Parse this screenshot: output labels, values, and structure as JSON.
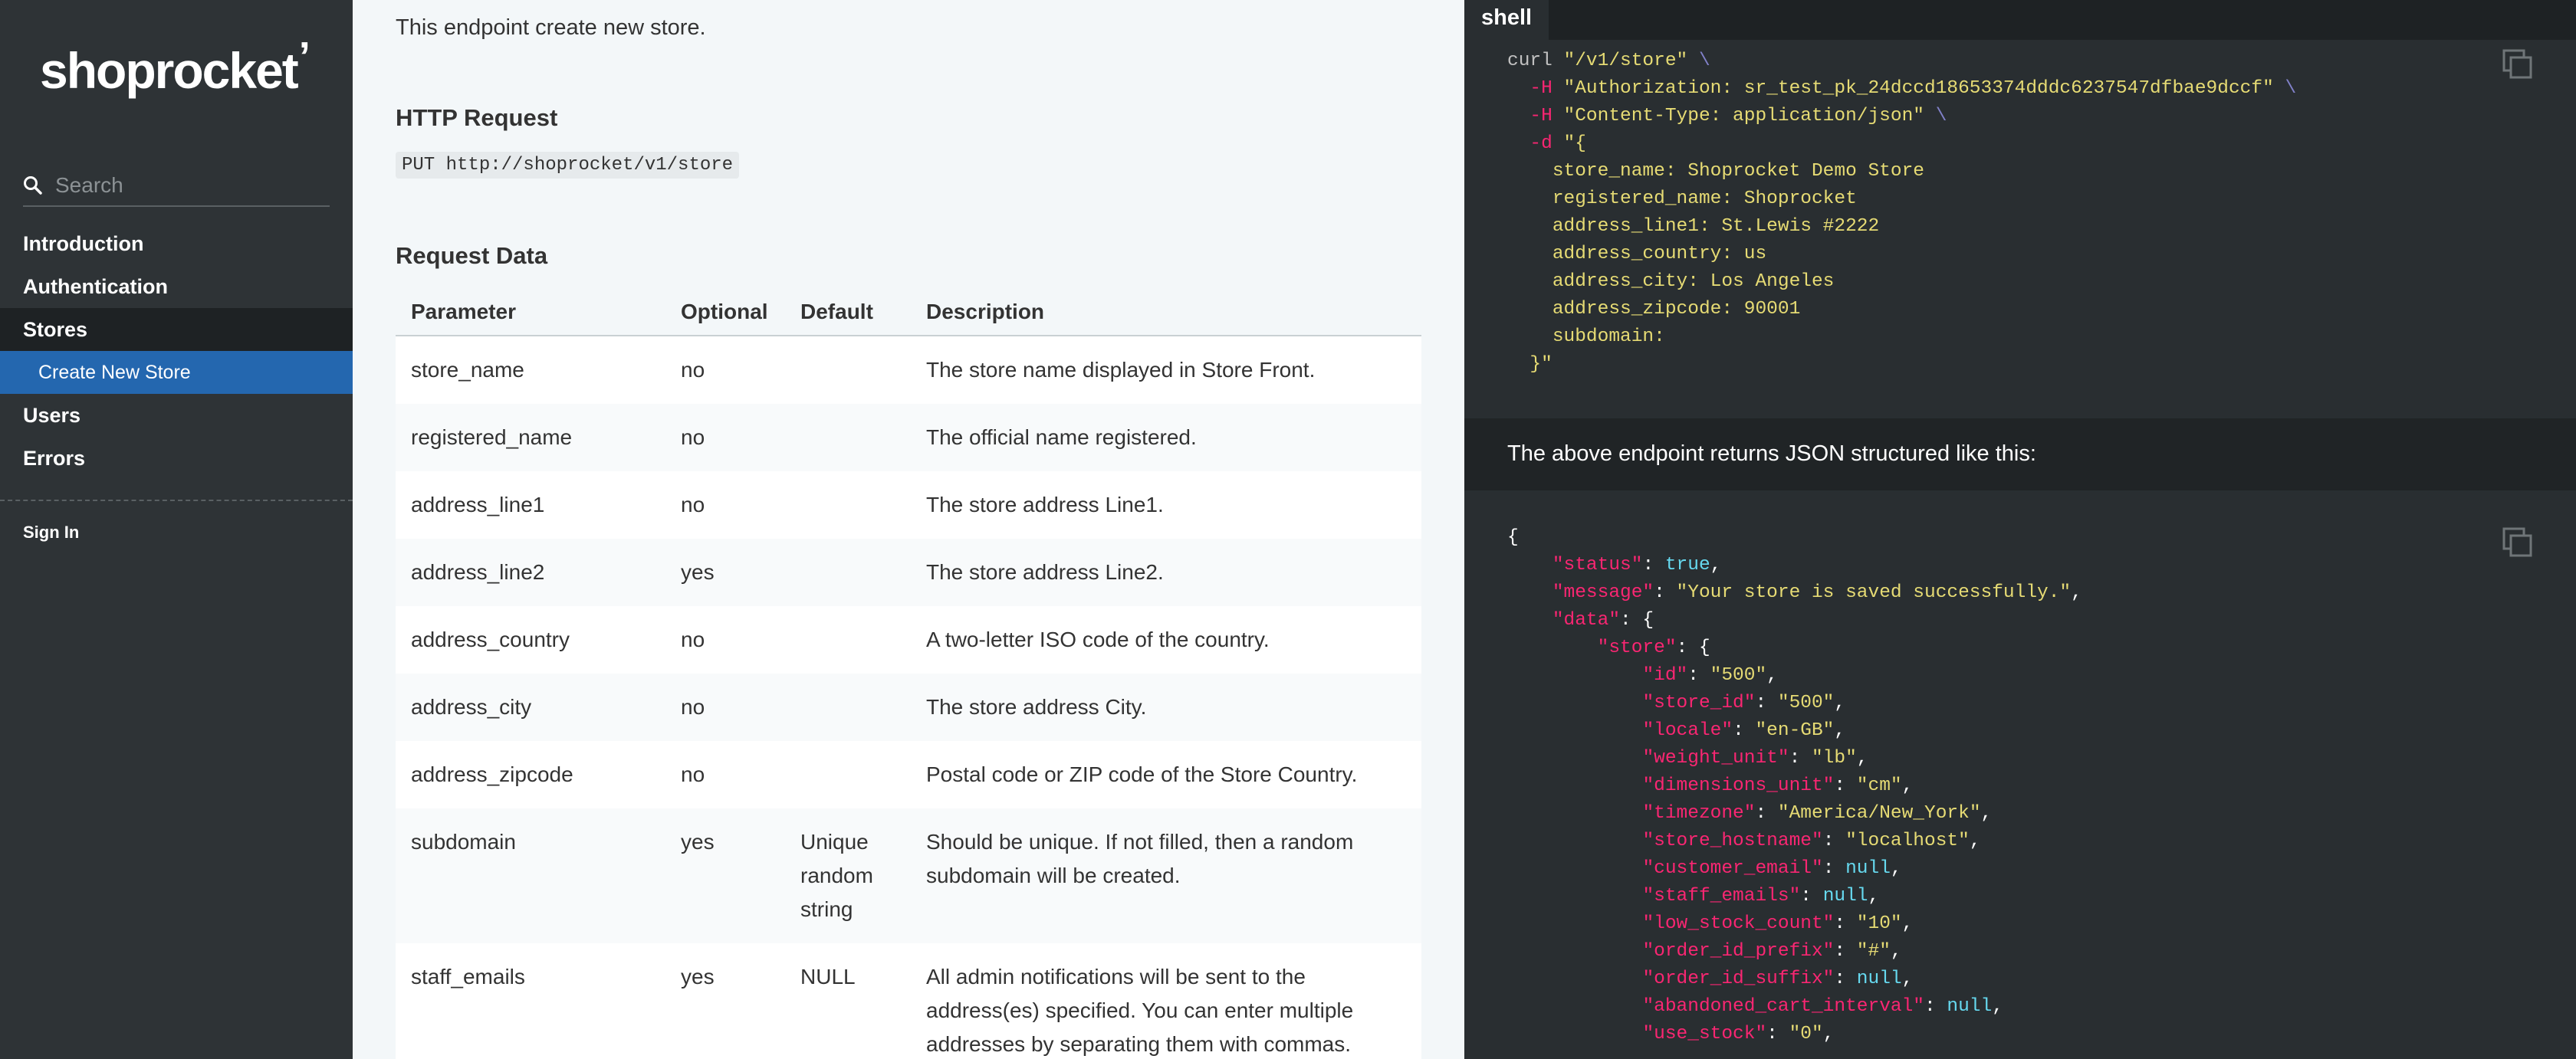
{
  "sidebar": {
    "logo": "shoprocket",
    "search_placeholder": "Search",
    "items": [
      {
        "label": "Introduction"
      },
      {
        "label": "Authentication"
      },
      {
        "label": "Stores"
      },
      {
        "label": "Create New Store"
      },
      {
        "label": "Users"
      },
      {
        "label": "Errors"
      }
    ],
    "sign_in": "Sign In"
  },
  "content": {
    "intro": "This endpoint create new store.",
    "http_heading": "HTTP Request",
    "http_code": "PUT http://shoprocket/v1/store",
    "request_heading": "Request Data",
    "table": {
      "headers": [
        "Parameter",
        "Optional",
        "Default",
        "Description"
      ],
      "rows": [
        {
          "param": "store_name",
          "optional": "no",
          "default": "",
          "desc": "The store name displayed in Store Front."
        },
        {
          "param": "registered_name",
          "optional": "no",
          "default": "",
          "desc": "The official name registered."
        },
        {
          "param": "address_line1",
          "optional": "no",
          "default": "",
          "desc": "The store address Line1."
        },
        {
          "param": "address_line2",
          "optional": "yes",
          "default": "",
          "desc": "The store address Line2."
        },
        {
          "param": "address_country",
          "optional": "no",
          "default": "",
          "desc": "A two-letter ISO code of the country."
        },
        {
          "param": "address_city",
          "optional": "no",
          "default": "",
          "desc": "The store address City."
        },
        {
          "param": "address_zipcode",
          "optional": "no",
          "default": "",
          "desc": "Postal code or ZIP code of the Store Country."
        },
        {
          "param": "subdomain",
          "optional": "yes",
          "default": "Unique random string",
          "desc": "Should be unique. If not filled, then a random subdomain will be created."
        },
        {
          "param": "staff_emails",
          "optional": "yes",
          "default": "NULL",
          "desc": "All admin notifications will be sent to the address(es) specified. You can enter multiple addresses by separating them with commas."
        }
      ]
    }
  },
  "code": {
    "tab": "shell",
    "curl": {
      "cmd": "curl",
      "url": "\"/v1/store\"",
      "h1_flag": "-H",
      "h1": "\"Authorization: sr_test_pk_24dccd18653374dddc6237547dfbae9dccf\"",
      "h2_flag": "-H",
      "h2": "\"Content-Type: application/json\"",
      "d_flag": "-d",
      "d_open": "\"{",
      "fields": [
        "store_name: Shoprocket Demo Store",
        "registered_name: Shoprocket",
        "address_line1: St.Lewis #2222",
        "address_country: us",
        "address_city: Los Angeles",
        "address_zipcode: 90001",
        "subdomain:"
      ],
      "d_close": "}\""
    },
    "returns_text": "The above endpoint returns JSON structured like this:",
    "json": {
      "status_key": "\"status\"",
      "status_val": "true",
      "message_key": "\"message\"",
      "message_val": "\"Your store is saved successfully.\"",
      "data_key": "\"data\"",
      "store_key": "\"store\"",
      "fields": [
        {
          "k": "\"id\"",
          "v": "\"500\"",
          "t": "str"
        },
        {
          "k": "\"store_id\"",
          "v": "\"500\"",
          "t": "str"
        },
        {
          "k": "\"locale\"",
          "v": "\"en-GB\"",
          "t": "str"
        },
        {
          "k": "\"weight_unit\"",
          "v": "\"lb\"",
          "t": "str"
        },
        {
          "k": "\"dimensions_unit\"",
          "v": "\"cm\"",
          "t": "str"
        },
        {
          "k": "\"timezone\"",
          "v": "\"America/New_York\"",
          "t": "str"
        },
        {
          "k": "\"store_hostname\"",
          "v": "\"localhost\"",
          "t": "str"
        },
        {
          "k": "\"customer_email\"",
          "v": "null",
          "t": "lit"
        },
        {
          "k": "\"staff_emails\"",
          "v": "null",
          "t": "lit"
        },
        {
          "k": "\"low_stock_count\"",
          "v": "\"10\"",
          "t": "str"
        },
        {
          "k": "\"order_id_prefix\"",
          "v": "\"#\"",
          "t": "str"
        },
        {
          "k": "\"order_id_suffix\"",
          "v": "null",
          "t": "lit"
        },
        {
          "k": "\"abandoned_cart_interval\"",
          "v": "null",
          "t": "lit"
        },
        {
          "k": "\"use_stock\"",
          "v": "\"0\"",
          "t": "str"
        }
      ]
    }
  }
}
